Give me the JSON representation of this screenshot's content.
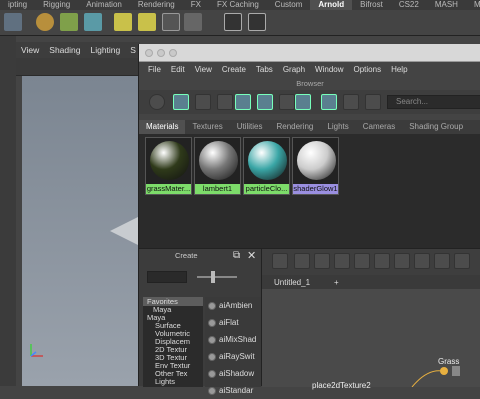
{
  "shelf_tabs": [
    "ipting",
    "Rigging",
    "Animation",
    "Rendering",
    "FX",
    "FX Caching",
    "Custom",
    "Arnold",
    "Bifrost",
    "CS22",
    "MASH",
    "Moti"
  ],
  "active_shelf_tab": "Arnold",
  "viewport": {
    "menu": [
      "View",
      "Shading",
      "Lighting",
      "S"
    ]
  },
  "hypershade": {
    "menu": [
      "File",
      "Edit",
      "View",
      "Create",
      "Tabs",
      "Graph",
      "Window",
      "Options",
      "Help"
    ],
    "browser_label": "Browser",
    "search_placeholder": "Search...",
    "browser_tabs": [
      "Materials",
      "Textures",
      "Utilities",
      "Rendering",
      "Lights",
      "Cameras",
      "Shading Group"
    ],
    "active_browser_tab": "Materials",
    "materials": [
      {
        "label": "grassMater...",
        "ball": "#2f3a1a",
        "label_bg": "#7ddc6a"
      },
      {
        "label": "lambert1",
        "ball": "#777777",
        "label_bg": "#7ddc6a"
      },
      {
        "label": "particleClo...",
        "ball": "#3aa6a6",
        "label_bg": "#7ddc6a"
      },
      {
        "label": "shaderGlow1",
        "ball": "#cccccc",
        "label_bg": "#9a8fe0"
      }
    ],
    "create": {
      "title": "Create",
      "tree": [
        "Favorites",
        "Maya",
        "Maya",
        "Surface",
        "Volumetric",
        "Displacem",
        "2D Textur",
        "3D Textur",
        "Env Textur",
        "Other Tex",
        "Lights"
      ],
      "nodes": [
        "aiAmbien",
        "aiFlat",
        "aiMixShad",
        "aiRaySwit",
        "aiShadow",
        "aiStandar"
      ]
    },
    "node_editor": {
      "tabs": [
        "Untitled_1",
        "+"
      ],
      "node_labels": [
        "Grass",
        "place2dTexture2"
      ]
    }
  }
}
